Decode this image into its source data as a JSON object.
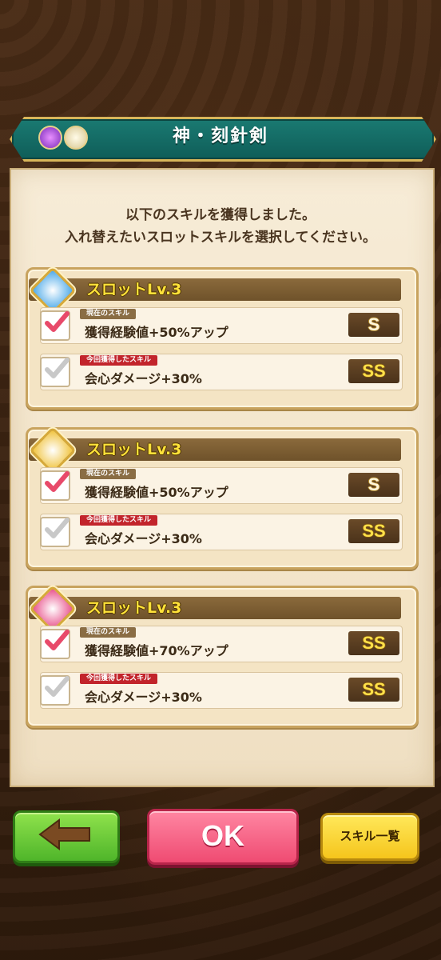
{
  "header": {
    "title": "神・刻針剣"
  },
  "instruction": {
    "line1": "以下のスキルを獲得しました。",
    "line2": "入れ替えたいスロットスキルを選択してください。"
  },
  "slots": [
    {
      "title": "スロットLv.3",
      "emblem_color": "#4aa8e8",
      "current": {
        "tag": "現在のスキル",
        "name": "獲得経験値+50%アップ",
        "rank": "S",
        "checked": true
      },
      "new": {
        "tag": "今回獲得したスキル",
        "name": "会心ダメージ+30%",
        "rank": "SS",
        "checked": false
      }
    },
    {
      "title": "スロットLv.3",
      "emblem_color": "#f0c23a",
      "current": {
        "tag": "現在のスキル",
        "name": "獲得経験値+50%アップ",
        "rank": "S",
        "checked": true
      },
      "new": {
        "tag": "今回獲得したスキル",
        "name": "会心ダメージ+30%",
        "rank": "SS",
        "checked": false
      }
    },
    {
      "title": "スロットLv.3",
      "emblem_color": "#e8508a",
      "current": {
        "tag": "現在のスキル",
        "name": "獲得経験値+70%アップ",
        "rank": "SS",
        "checked": true
      },
      "new": {
        "tag": "今回獲得したスキル",
        "name": "会心ダメージ+30%",
        "rank": "SS",
        "checked": false
      }
    }
  ],
  "buttons": {
    "ok": "OK",
    "skill_list": "スキル一覧",
    "back_icon": "arrow-left-icon"
  },
  "colors": {
    "check_active": "#e84a6a",
    "check_inactive": "#c8c8c8"
  }
}
